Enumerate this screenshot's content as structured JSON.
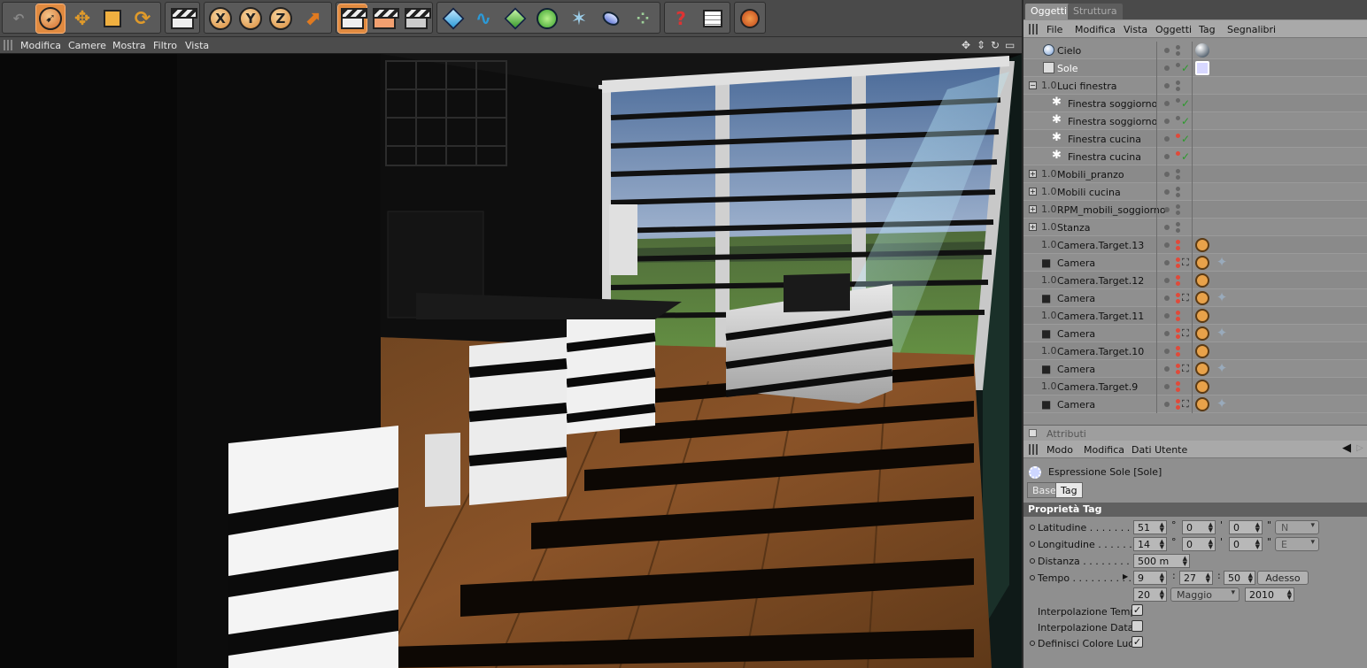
{
  "viewport_menu": {
    "items": [
      "Modifica",
      "Camere",
      "Mostra",
      "Filtro",
      "Vista"
    ]
  },
  "toolbar": {
    "icons": [
      "undo-icon",
      "select-arrow-icon",
      "move-icon",
      "scale-icon",
      "rotate-icon",
      "render-clapper-icon",
      "x-axis-icon",
      "y-axis-icon",
      "z-axis-icon",
      "coordinate-system-icon",
      "render-view-icon",
      "render-picture-icon",
      "render-settings-icon",
      "cube-icon",
      "spline-icon",
      "nurbs-icon",
      "array-icon",
      "deformer-icon",
      "environment-icon",
      "particles-icon",
      "help-icon",
      "table-icon",
      "web-icon"
    ],
    "axis_labels": [
      "X",
      "Y",
      "Z"
    ]
  },
  "objects_panel": {
    "tabs": [
      "Oggetti",
      "Struttura"
    ],
    "menu": [
      "File",
      "Modifica",
      "Vista",
      "Oggetti",
      "Tag",
      "Segnalibri"
    ],
    "rows": [
      {
        "name": "Cielo"
      },
      {
        "name": "Sole"
      },
      {
        "name": "Luci finestra"
      },
      {
        "name": "Finestra soggiorno"
      },
      {
        "name": "Finestra soggiorno"
      },
      {
        "name": "Finestra cucina"
      },
      {
        "name": "Finestra cucina"
      },
      {
        "name": "Mobili_pranzo"
      },
      {
        "name": "Mobili cucina"
      },
      {
        "name": "RPM_mobili_soggiorno"
      },
      {
        "name": "Stanza"
      },
      {
        "name": "Camera.Target.13"
      },
      {
        "name": "Camera"
      },
      {
        "name": "Camera.Target.12"
      },
      {
        "name": "Camera"
      },
      {
        "name": "Camera.Target.11"
      },
      {
        "name": "Camera"
      },
      {
        "name": "Camera.Target.10"
      },
      {
        "name": "Camera"
      },
      {
        "name": "Camera.Target.9"
      },
      {
        "name": "Camera"
      }
    ]
  },
  "attributes_panel": {
    "title": "Attributi",
    "menu": [
      "Modo",
      "Modifica",
      "Dati Utente"
    ],
    "object_title": "Espressione Sole [Sole]",
    "tabs": [
      "Base",
      "Tag"
    ],
    "section": "Proprietà Tag",
    "labels": {
      "latitude": "Latitudine . . . . . . . . .",
      "longitude": "Longitudine . . . . . . .",
      "distance": "Distanza . . . . . . . . . . .",
      "time": "Tempo . . . . . . . . . ."
    },
    "latitude": {
      "deg": "51",
      "min": "0",
      "sec": "0",
      "dir": "N"
    },
    "longitude": {
      "deg": "14",
      "min": "0",
      "sec": "0",
      "dir": "E"
    },
    "distance": "500 m",
    "time": {
      "h": "9",
      "m": "27",
      "s": "50",
      "now_button": "Adesso"
    },
    "date": {
      "day": "20",
      "month": "Maggio",
      "year": "2010"
    },
    "deg_symbol": "°",
    "min_symbol": "'",
    "sec_symbol": "\"",
    "colon": ":",
    "checkboxes": [
      {
        "label": "Interpolazione Tempo",
        "checked": true
      },
      {
        "label": "Interpolazione Data",
        "checked": false
      },
      {
        "label": "Definisci Colore Luce",
        "checked": true
      }
    ],
    "check_glyph": "✓"
  }
}
